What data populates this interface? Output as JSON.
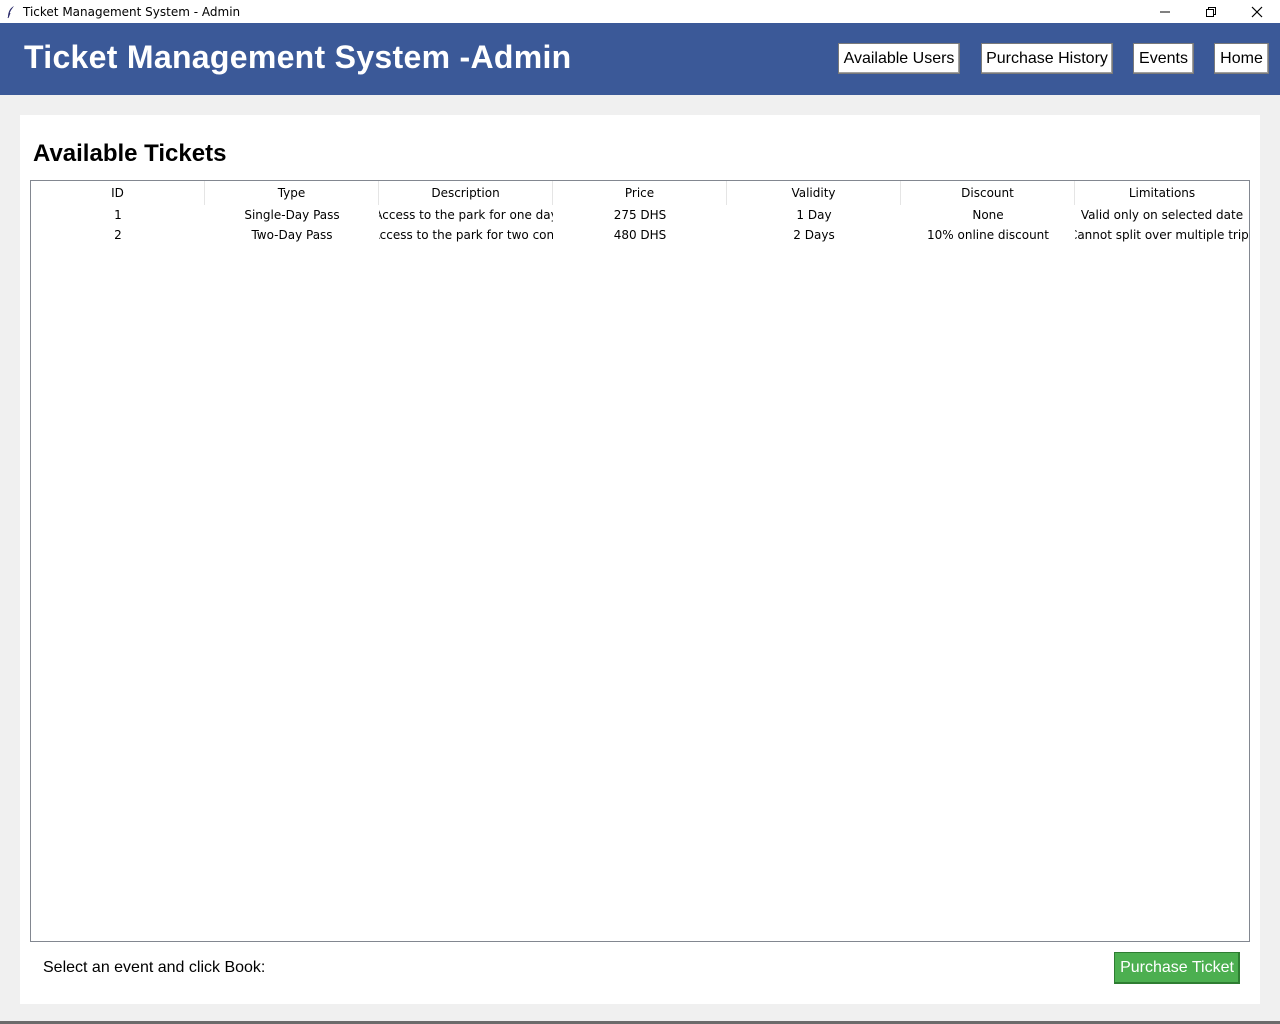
{
  "window": {
    "title": "Ticket Management System - Admin"
  },
  "header": {
    "title": "Ticket Management System -Admin",
    "nav": {
      "available_users": "Available Users",
      "purchase_history": "Purchase History",
      "events": "Events",
      "home": "Home"
    }
  },
  "main": {
    "heading": "Available Tickets",
    "table": {
      "columns": [
        "ID",
        "Type",
        "Description",
        "Price",
        "Validity",
        "Discount",
        "Limitations"
      ],
      "rows": [
        [
          "1",
          "Single-Day Pass",
          "Access to the park for one day",
          "275 DHS",
          "1 Day",
          "None",
          "Valid only on selected date"
        ],
        [
          "2",
          "Two-Day Pass",
          "Access to the park for two cons",
          "480 DHS",
          "2 Days",
          "10% online discount",
          "Cannot split over multiple trips"
        ]
      ]
    },
    "hint": "Select an event and click Book:",
    "purchase_button": "Purchase Ticket"
  },
  "colors": {
    "header_bg": "#3b5998",
    "purchase_button_bg": "#4caf50"
  },
  "icons": {
    "app": "feather-icon",
    "minimize": "minimize-icon",
    "restore": "restore-icon",
    "close": "close-icon"
  }
}
